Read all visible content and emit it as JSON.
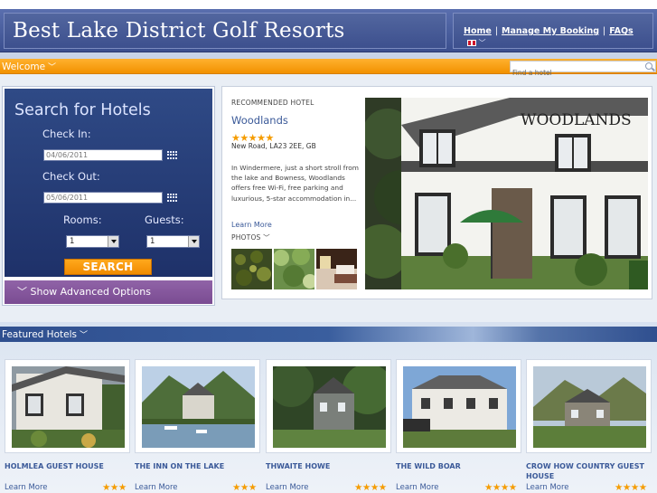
{
  "header": {
    "title": "Best Lake District Golf Resorts",
    "nav": [
      "Home",
      "Manage My Booking",
      "FAQs"
    ],
    "nav_separator": "|"
  },
  "welcome_bar": {
    "label": "Welcome",
    "search_placeholder": "Find a hotel"
  },
  "search_panel": {
    "title": "Search for Hotels",
    "check_in_label": "Check In:",
    "check_in_value": "04/06/2011",
    "check_out_label": "Check Out:",
    "check_out_value": "05/06/2011",
    "rooms_label": "Rooms:",
    "rooms_value": "1",
    "guests_label": "Guests:",
    "guests_value": "1",
    "search_button": "SEARCH",
    "advanced_label": "Show Advanced Options"
  },
  "recommended": {
    "tag": "RECOMMENDED HOTEL",
    "name": "Woodlands",
    "stars": "★★★★★",
    "star_count": 5,
    "address": "New Road, LA23 2EE, GB",
    "description": "In Windermere, just a short stroll from the lake and Bowness, Woodlands offers free Wi-Fi, free parking and luxurious, 5-star accommodation in...",
    "learn_more": "Learn More",
    "photos_label": "PHOTOS",
    "sign_text": "WOODLANDS"
  },
  "featured": {
    "label": "Featured Hotels",
    "hotels": [
      {
        "name": "HOLMLEA GUEST HOUSE",
        "learn_more": "Learn More",
        "stars": "★★★",
        "star_count": 3
      },
      {
        "name": "THE INN ON THE LAKE",
        "learn_more": "Learn More",
        "stars": "★★★",
        "star_count": 3
      },
      {
        "name": "THWAITE HOWE",
        "learn_more": "Learn More",
        "stars": "★★★★",
        "star_count": 4
      },
      {
        "name": "THE WILD BOAR",
        "learn_more": "Learn More",
        "stars": "★★★★",
        "star_count": 4
      },
      {
        "name": "CROW HOW COUNTRY GUEST HOUSE",
        "learn_more": "Learn More",
        "stars": "★★★★",
        "star_count": 4
      }
    ]
  },
  "colors": {
    "header_blue": "#3b4f8f",
    "accent_orange": "#f29100",
    "link_blue": "#3b5a99",
    "star_gold": "#f59c00",
    "advanced_purple": "#7a4b92"
  }
}
